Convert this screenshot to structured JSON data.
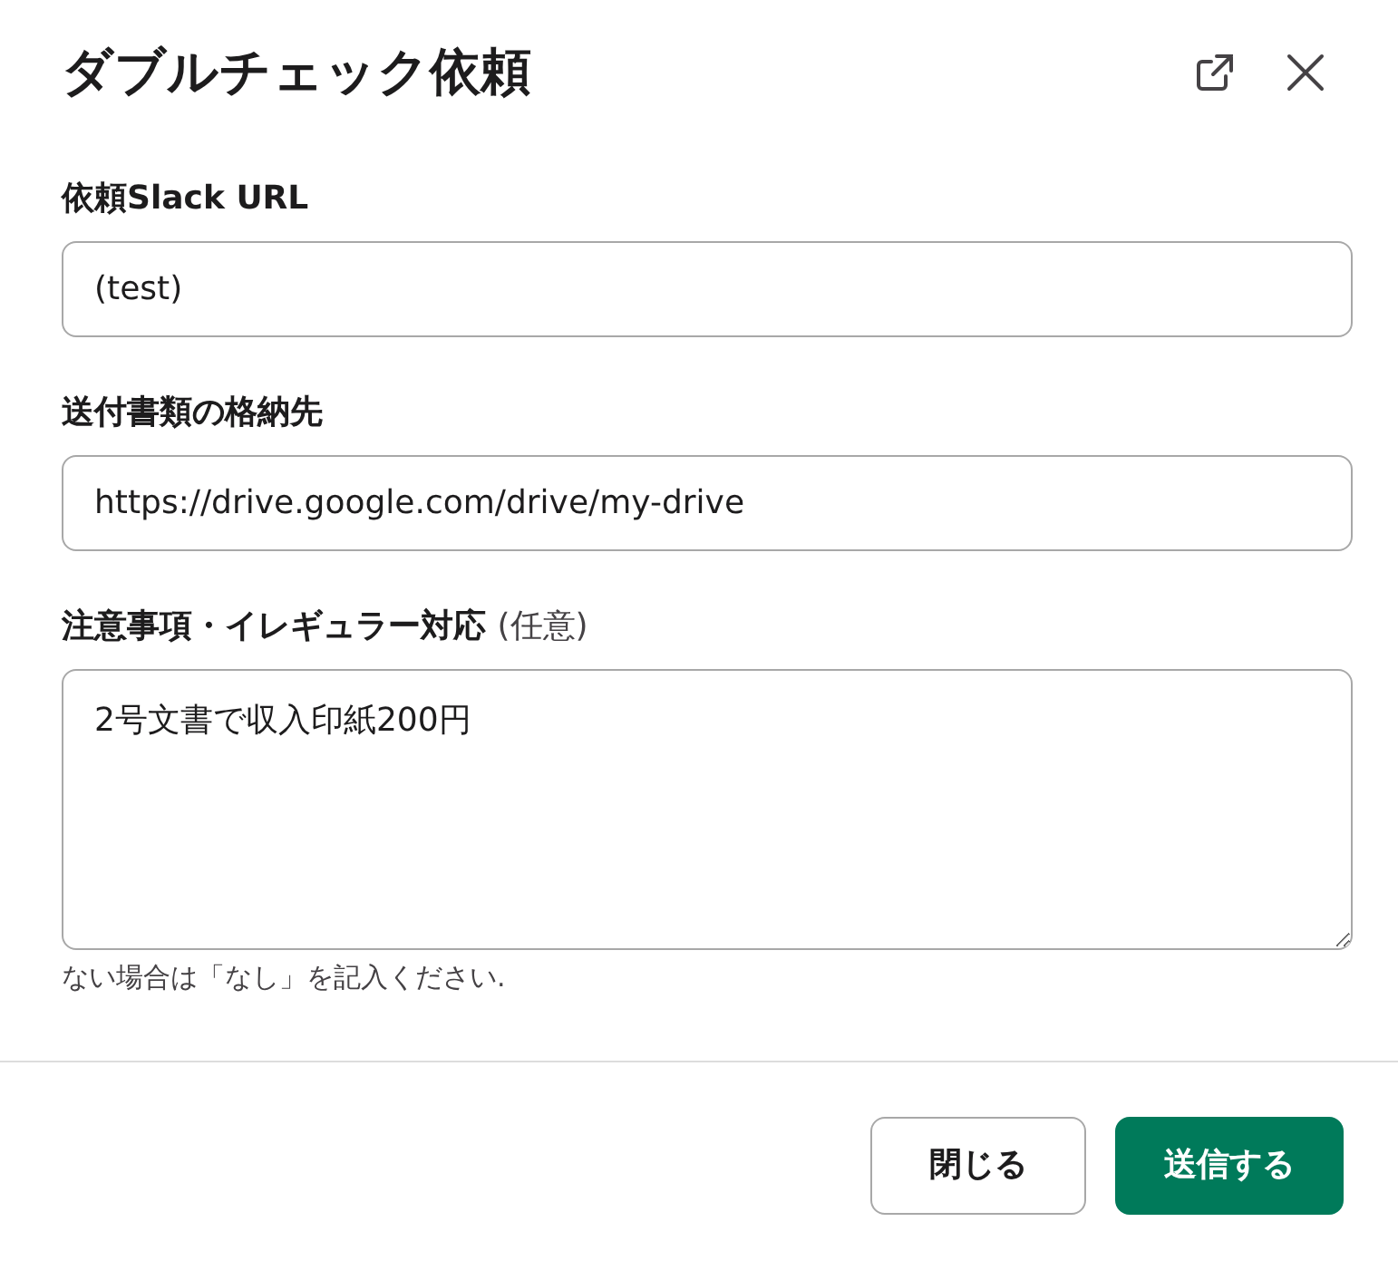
{
  "modal": {
    "title": "ダブルチェック依頼"
  },
  "fields": [
    {
      "kind": "input",
      "label": "依頼Slack URL",
      "value": "(test)"
    },
    {
      "kind": "input",
      "label": "送付書類の格納先",
      "value": "https://drive.google.com/drive/my-drive"
    },
    {
      "kind": "textarea",
      "label": "注意事項・イレギュラー対応",
      "note": "(任意)",
      "value": "2号文書で収入印紙200円",
      "hint": "ない場合は「なし」を記入ください."
    }
  ],
  "buttons": [
    {
      "kind": "secondary",
      "label": "閉じる"
    },
    {
      "kind": "primary",
      "label": "送信する"
    }
  ]
}
